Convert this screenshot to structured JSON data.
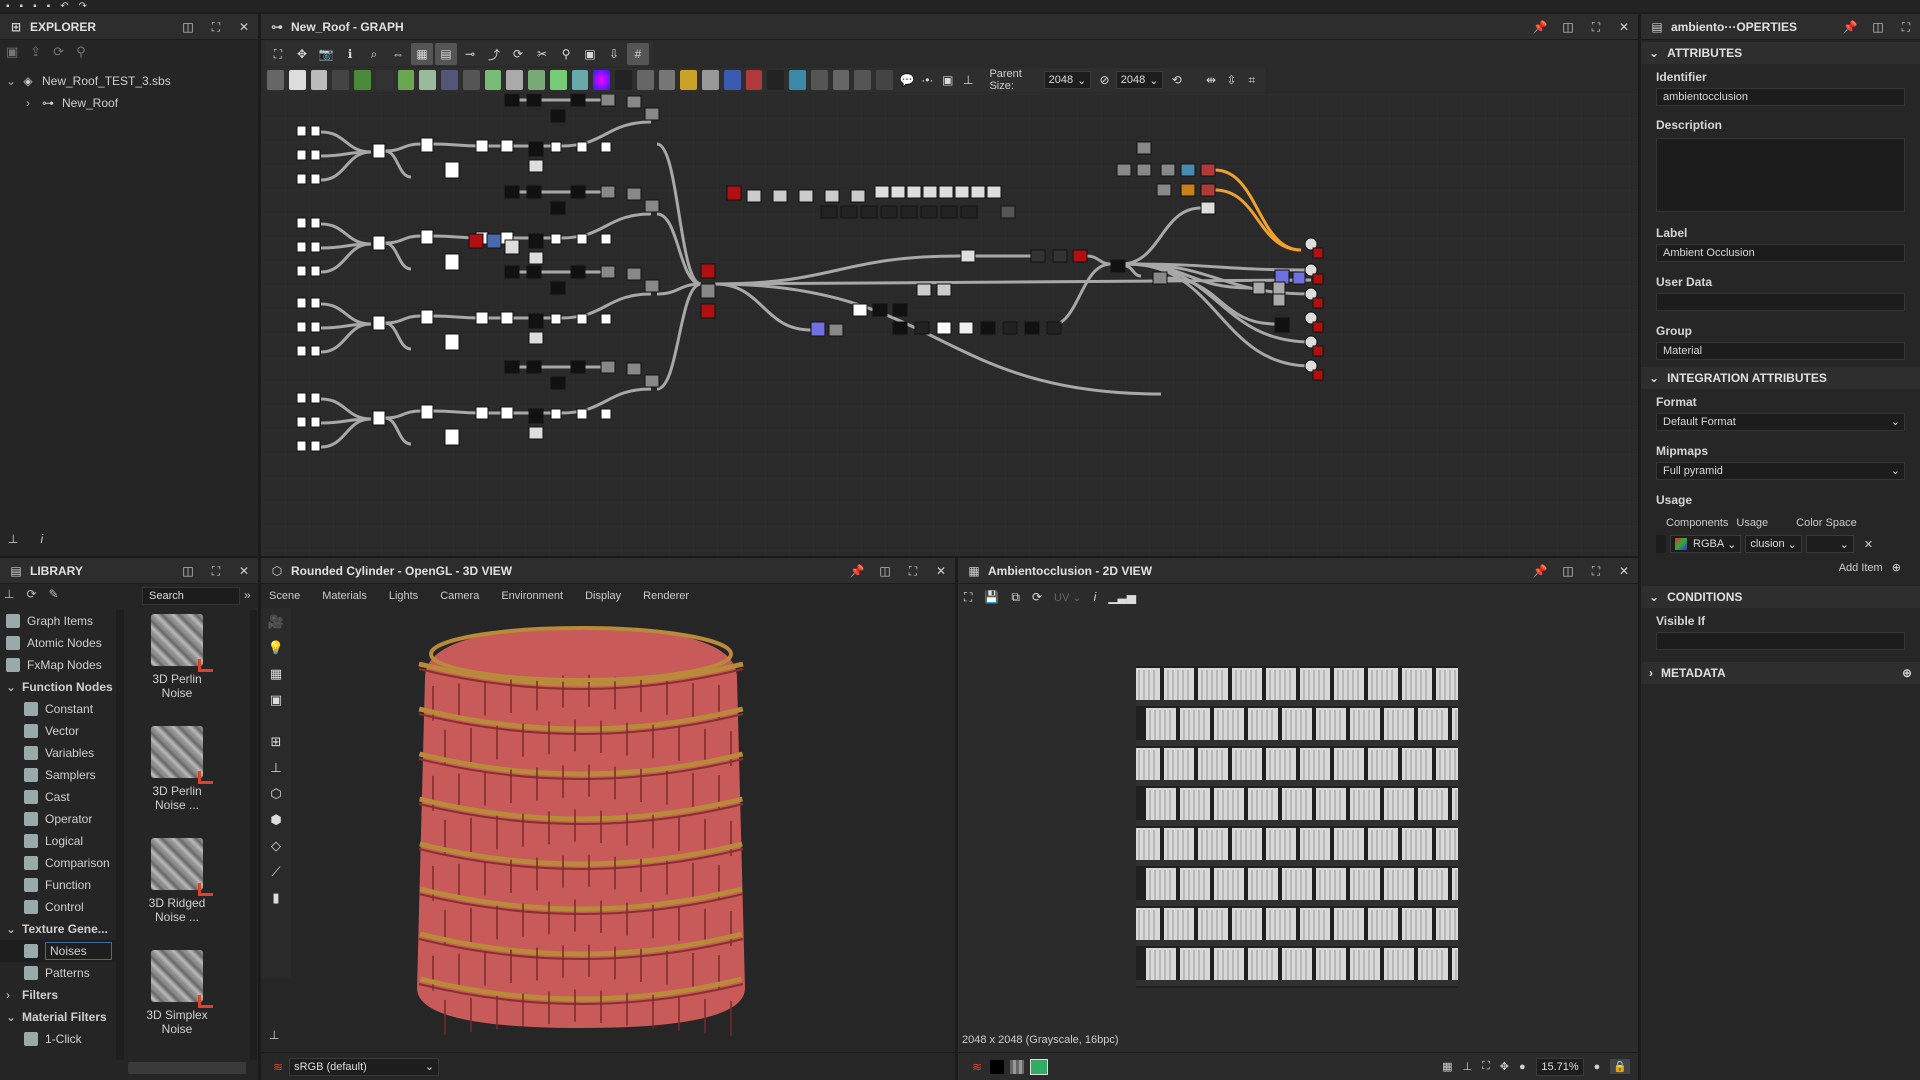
{
  "app": {
    "quick_toolbar_icons": [
      "new-icon",
      "open-icon",
      "save-icon",
      "save-all-icon",
      "undo-icon",
      "redo-icon"
    ]
  },
  "explorer": {
    "title": "EXPLORER",
    "package_name": "New_Roof_TEST_3.sbs",
    "graph_name": "New_Roof"
  },
  "graph": {
    "title": "New_Roof - GRAPH",
    "parent_size_label": "Parent Size:",
    "parent_size_value": "2048",
    "size_value": "2048",
    "colors": {
      "wire": "#a8a8a8",
      "wire_highlight": "#f0a030",
      "canvas": "#2a2a2a",
      "grid": "#303030",
      "red_node": "#b01010",
      "blue_node": "#7070e0"
    }
  },
  "view3d": {
    "title": "Rounded Cylinder - OpenGL - 3D VIEW",
    "menu": [
      "Scene",
      "Materials",
      "Lights",
      "Camera",
      "Environment",
      "Display",
      "Renderer"
    ],
    "colorspace": "sRGB (default)",
    "colors": {
      "roof": "#c85a5a",
      "moss": "#b88a3a"
    }
  },
  "view2d": {
    "title": "Ambientocclusion - 2D VIEW",
    "uv_label": "UV",
    "status": "2048 x 2048 (Grayscale, 16bpc)",
    "zoom": "15.71%"
  },
  "library": {
    "title": "LIBRARY",
    "search_placeholder": "Search",
    "tree": [
      {
        "label": "Graph Items",
        "level": 0,
        "kind": "item"
      },
      {
        "label": "Atomic Nodes",
        "level": 0,
        "kind": "item"
      },
      {
        "label": "FxMap Nodes",
        "level": 0,
        "kind": "item"
      },
      {
        "label": "Function Nodes",
        "level": 0,
        "kind": "group-open"
      },
      {
        "label": "Constant",
        "level": 1,
        "kind": "item"
      },
      {
        "label": "Vector",
        "level": 1,
        "kind": "item"
      },
      {
        "label": "Variables",
        "level": 1,
        "kind": "item"
      },
      {
        "label": "Samplers",
        "level": 1,
        "kind": "item"
      },
      {
        "label": "Cast",
        "level": 1,
        "kind": "item"
      },
      {
        "label": "Operator",
        "level": 1,
        "kind": "item"
      },
      {
        "label": "Logical",
        "level": 1,
        "kind": "item"
      },
      {
        "label": "Comparison",
        "level": 1,
        "kind": "item"
      },
      {
        "label": "Function",
        "level": 1,
        "kind": "item"
      },
      {
        "label": "Control",
        "level": 1,
        "kind": "item"
      },
      {
        "label": "Texture Gene...",
        "level": 0,
        "kind": "group-open"
      },
      {
        "label": "Noises",
        "level": 1,
        "kind": "selected"
      },
      {
        "label": "Patterns",
        "level": 1,
        "kind": "item"
      },
      {
        "label": "Filters",
        "level": 0,
        "kind": "group-closed"
      },
      {
        "label": "Material Filters",
        "level": 0,
        "kind": "group-open"
      },
      {
        "label": "1-Click",
        "level": 1,
        "kind": "item"
      }
    ],
    "tiles": [
      {
        "line1": "3D Perlin",
        "line2": "Noise"
      },
      {
        "line1": "3D Perlin",
        "line2": "Noise ..."
      },
      {
        "line1": "3D Ridged",
        "line2": "Noise ..."
      },
      {
        "line1": "3D Simplex",
        "line2": "Noise"
      }
    ]
  },
  "properties": {
    "title": "ambiento···OPERTIES",
    "attributes_section": "ATTRIBUTES",
    "identifier_label": "Identifier",
    "identifier_value": "ambientocclusion",
    "description_label": "Description",
    "label_label": "Label",
    "label_value": "Ambient Occlusion",
    "user_data_label": "User Data",
    "group_label": "Group",
    "group_value": "Material",
    "integration_section": "INTEGRATION ATTRIBUTES",
    "format_label": "Format",
    "format_value": "Default Format",
    "mipmaps_label": "Mipmaps",
    "mipmaps_value": "Full pyramid",
    "usage_label": "Usage",
    "components_col": "Components",
    "usage_col": "Usage",
    "colorspace_col": "Color Space",
    "components_value": "RGBA",
    "usage_value": "clusion",
    "add_item": "Add Item",
    "conditions_section": "CONDITIONS",
    "visible_if_label": "Visible If",
    "metadata_section": "METADATA"
  }
}
